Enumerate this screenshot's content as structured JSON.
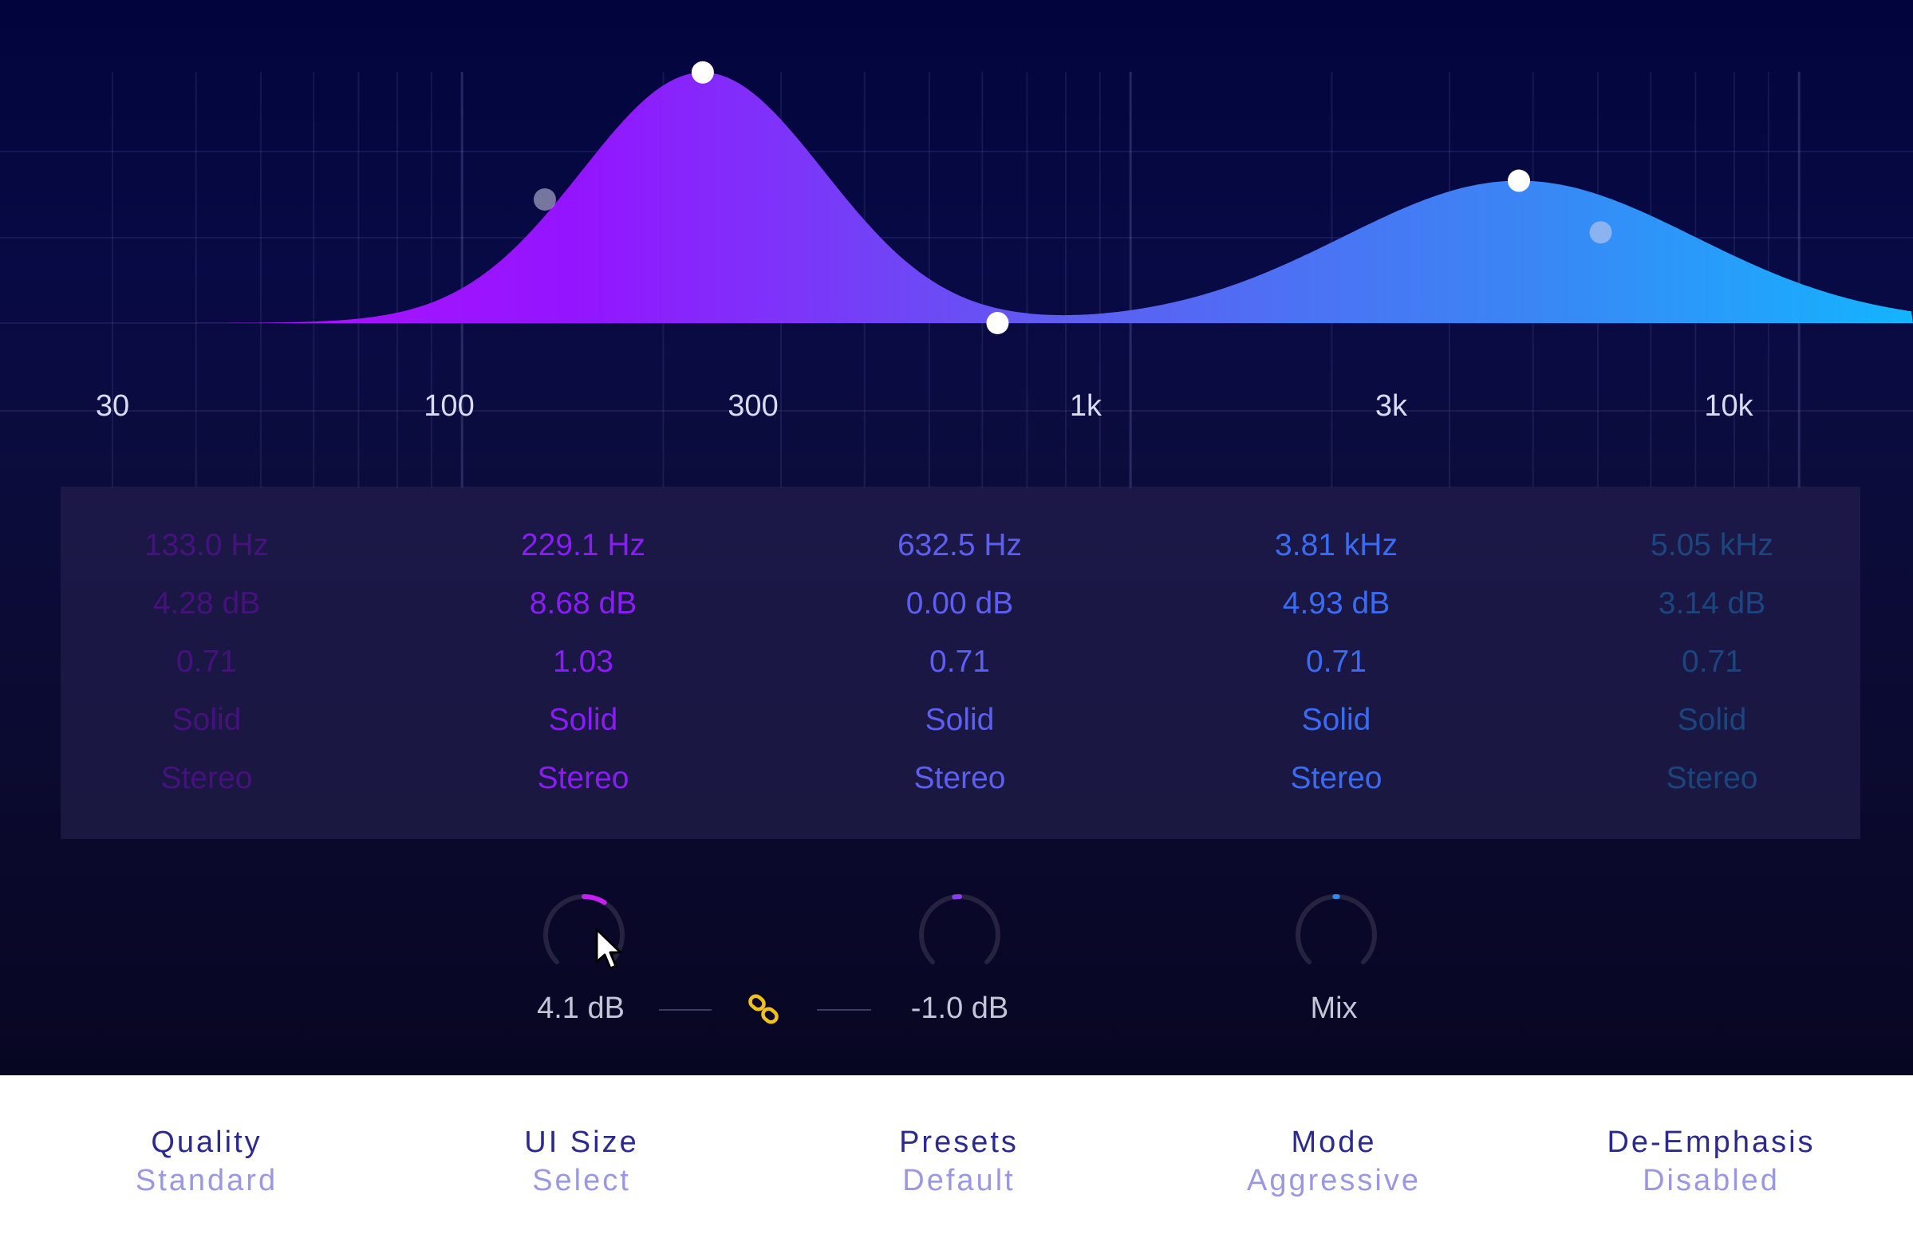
{
  "colors": {
    "band_magenta": "#a007f7",
    "band_purple": "#8a1cf7",
    "band_indigo": "#5c5ff2",
    "band_blue": "#3a6cf3",
    "band_cyan": "#1ca6fb",
    "link_icon": "#f2c21b",
    "footer_title": "#2d2a8e",
    "footer_value": "#9a98e2"
  },
  "freq_axis": {
    "labels": [
      "30",
      "100",
      "300",
      "1k",
      "3k",
      "10k"
    ]
  },
  "bands": [
    {
      "freq": "133.0 Hz",
      "gain": "4.28 dB",
      "q": "0.71",
      "shape": "Solid",
      "channel": "Stereo",
      "color": "#a007f7",
      "active": false
    },
    {
      "freq": "229.1 Hz",
      "gain": "8.68 dB",
      "q": "1.03",
      "shape": "Solid",
      "channel": "Stereo",
      "color": "#8a1cf7",
      "active": true
    },
    {
      "freq": "632.5 Hz",
      "gain": "0.00 dB",
      "q": "0.71",
      "shape": "Solid",
      "channel": "Stereo",
      "color": "#5c5ff2",
      "active": true
    },
    {
      "freq": "3.81 kHz",
      "gain": "4.93 dB",
      "q": "0.71",
      "shape": "Solid",
      "channel": "Stereo",
      "color": "#3a6cf3",
      "active": true
    },
    {
      "freq": "5.05 kHz",
      "gain": "3.14 dB",
      "q": "0.71",
      "shape": "Solid",
      "channel": "Stereo",
      "color": "#1ca6fb",
      "active": false
    }
  ],
  "knobs": {
    "input": {
      "label": "4.1 dB",
      "value_fraction": 0.62,
      "color": "#c321f0"
    },
    "output": {
      "label": "-1.0 dB",
      "value_fraction": 0.47,
      "color": "#8a3ef0"
    },
    "mix": {
      "label": "Mix",
      "value_fraction": 0.5,
      "color": "#2a8cf0"
    }
  },
  "link_icon": "chain-link-icon",
  "cursor_icon": "mouse-pointer-icon",
  "footer": [
    {
      "title": "Quality",
      "value": "Standard"
    },
    {
      "title": "UI Size",
      "value": "Select"
    },
    {
      "title": "Presets",
      "value": "Default"
    },
    {
      "title": "Mode",
      "value": "Aggressive"
    },
    {
      "title": "De-Emphasis",
      "value": "Disabled"
    }
  ]
}
